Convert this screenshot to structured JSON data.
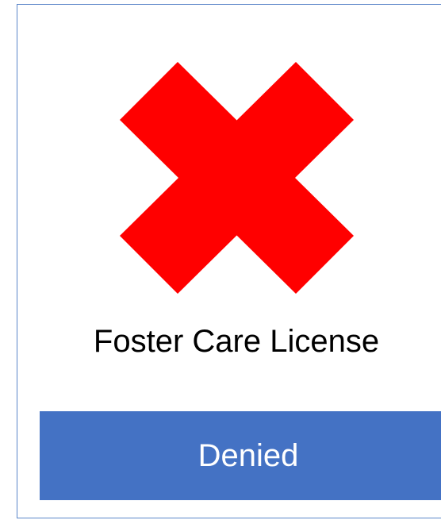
{
  "icon": "red-x-icon",
  "colors": {
    "icon": "#ff0000",
    "card_border": "#5b86c9",
    "status_bg": "#4472c4",
    "status_text": "#ffffff",
    "title_text": "#000000"
  },
  "title": "Foster Care License",
  "status": "Denied"
}
